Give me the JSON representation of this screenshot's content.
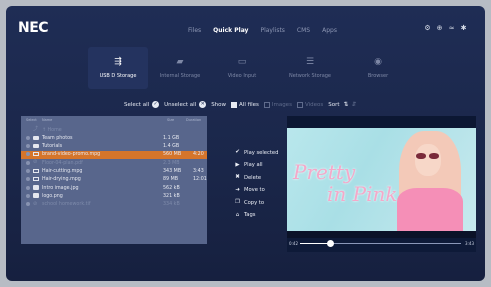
{
  "brand": "NEC",
  "nav_tabs": [
    {
      "label": "Files",
      "active": false
    },
    {
      "label": "Quick Play",
      "active": true
    },
    {
      "label": "Playlists",
      "active": false
    },
    {
      "label": "CMS",
      "active": false
    },
    {
      "label": "Apps",
      "active": false
    }
  ],
  "system_icons": [
    "settings-icon",
    "globe-icon",
    "wifi-icon",
    "gear-icon"
  ],
  "sources": [
    {
      "label": "USB D Storage",
      "icon": "usb-icon",
      "active": true
    },
    {
      "label": "Internal Storage",
      "icon": "folder-icon",
      "active": false
    },
    {
      "label": "Video Input",
      "icon": "monitor-icon",
      "active": false
    },
    {
      "label": "Network Storage",
      "icon": "server-icon",
      "active": false
    },
    {
      "label": "Browser",
      "icon": "browser-icon",
      "active": false
    }
  ],
  "toolbar": {
    "select_all": "Select all",
    "unselect_all": "Unselect all",
    "show": "Show",
    "all_files": "All files",
    "images": "Images",
    "videos": "Videos",
    "sort": "Sort"
  },
  "file_table": {
    "columns": [
      "Select",
      "Name",
      "Size",
      "Duration"
    ],
    "rows": [
      {
        "name": "↑ Home",
        "size": "",
        "duration": "",
        "type": "up",
        "disabled": true,
        "selected": false
      },
      {
        "name": "Team photos",
        "size": "1.1 GB",
        "duration": "",
        "type": "folder",
        "disabled": false,
        "selected": false
      },
      {
        "name": "Tutorials",
        "size": "1.4 GB",
        "duration": "",
        "type": "folder",
        "disabled": false,
        "selected": false
      },
      {
        "name": "brand-video-promo.mpg",
        "size": "560 MB",
        "duration": "4:20",
        "type": "video",
        "disabled": false,
        "selected": true
      },
      {
        "name": "Floor-04-plan.pdf",
        "size": "2.3 MB",
        "duration": "",
        "type": "blocked",
        "disabled": true,
        "selected": false
      },
      {
        "name": "Hair-cutting.mpg",
        "size": "343 MB",
        "duration": "3:43",
        "type": "video",
        "disabled": false,
        "selected": false
      },
      {
        "name": "Hair-drying.mpg",
        "size": "89 MB",
        "duration": "12:01",
        "type": "video",
        "disabled": false,
        "selected": false
      },
      {
        "name": "Intro image.jpg",
        "size": "562 kB",
        "duration": "",
        "type": "image",
        "disabled": false,
        "selected": false
      },
      {
        "name": "logo.png",
        "size": "321 kB",
        "duration": "",
        "type": "image",
        "disabled": false,
        "selected": false
      },
      {
        "name": "school homework.tif",
        "size": "334 kB",
        "duration": "",
        "type": "blocked",
        "disabled": true,
        "selected": false
      }
    ]
  },
  "actions": [
    {
      "label": "Play selected",
      "icon": "check-circle-icon"
    },
    {
      "label": "Play all",
      "icon": "play-icon"
    },
    {
      "label": "Delete",
      "icon": "delete-icon"
    },
    {
      "label": "Move to",
      "icon": "move-icon"
    },
    {
      "label": "Copy to",
      "icon": "copy-icon"
    },
    {
      "label": "Tags",
      "icon": "tag-icon"
    }
  ],
  "preview": {
    "title_line1": "Pretty",
    "title_line2": "in Pink",
    "time_current": "0:42",
    "time_total": "3:43",
    "progress": 0.19
  },
  "colors": {
    "accent": "#e07a2a",
    "background": "#1f2d55"
  }
}
